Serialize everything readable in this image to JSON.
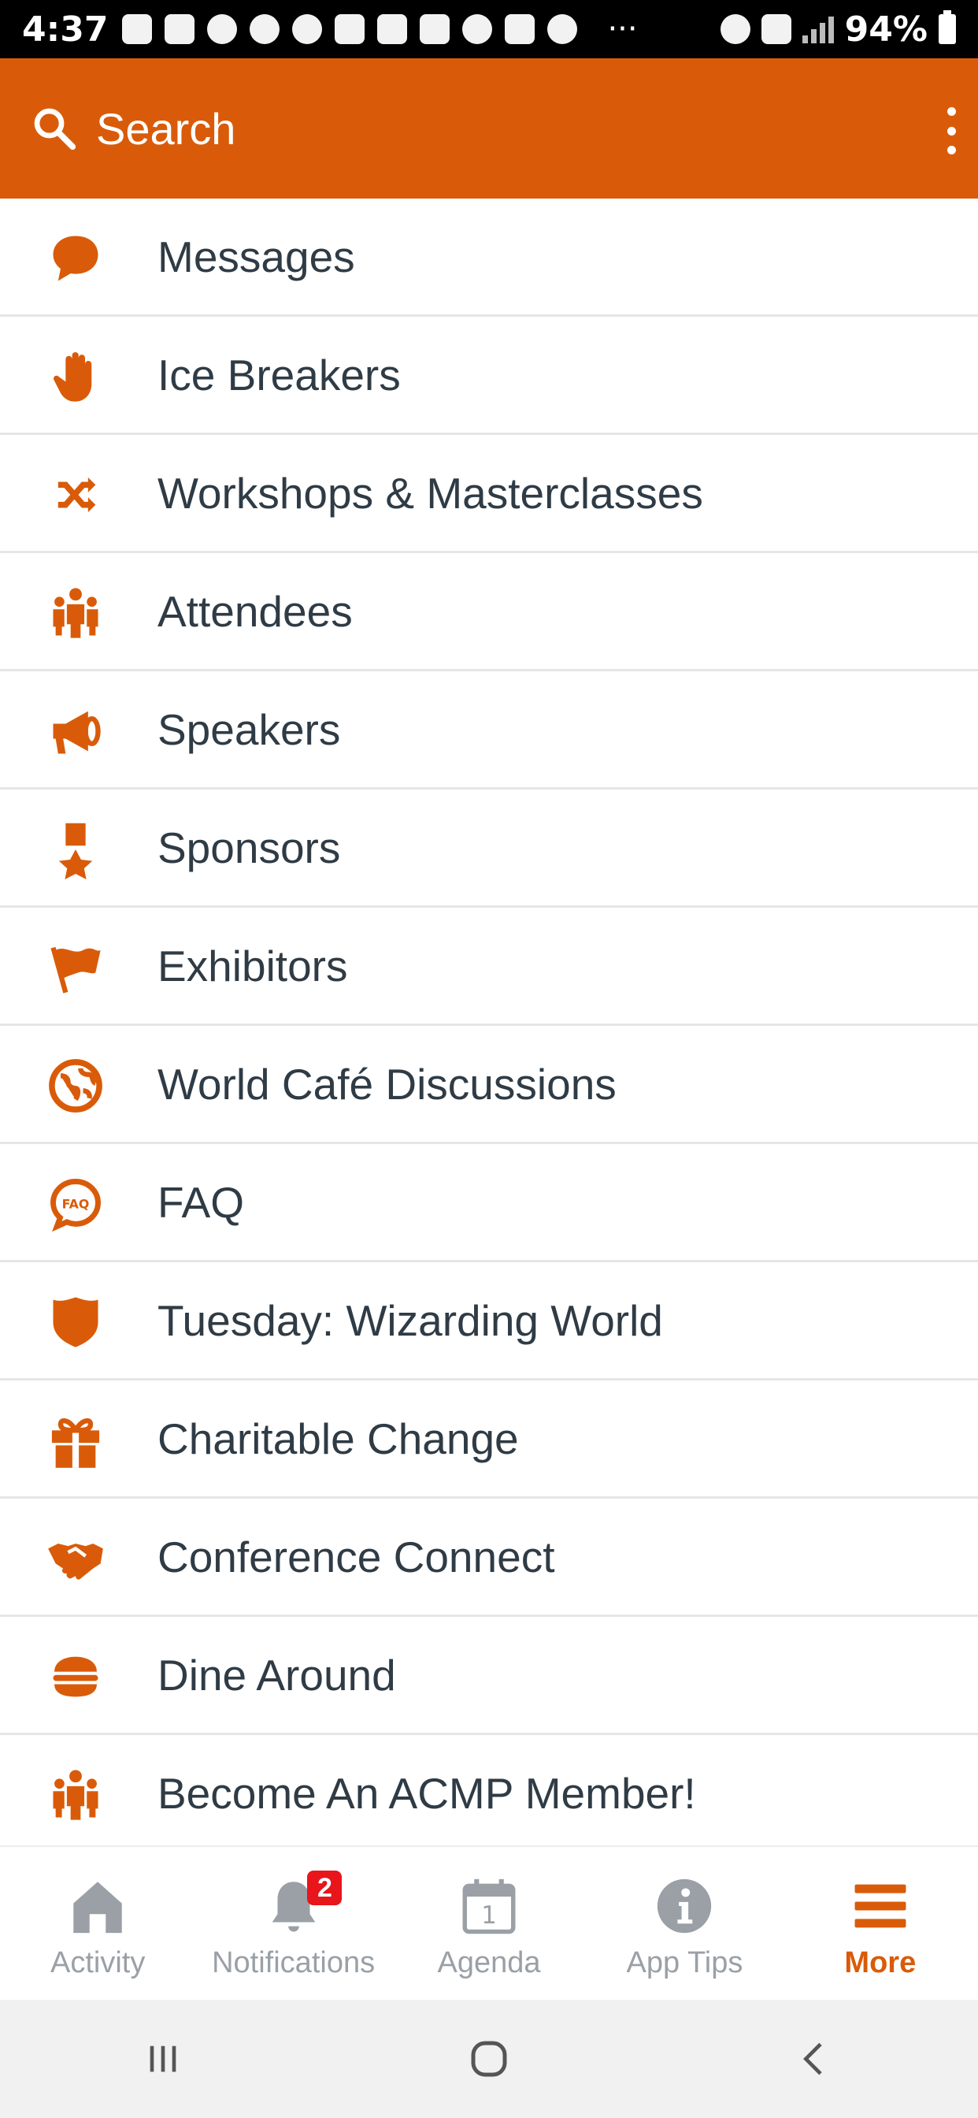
{
  "status_bar": {
    "time": "4:37",
    "battery": "94%"
  },
  "header": {
    "search_label": "Search",
    "accent_color": "#d95b09"
  },
  "menu": {
    "items": [
      {
        "label": "Messages",
        "icon": "chat-bubble-icon"
      },
      {
        "label": "Ice Breakers",
        "icon": "hand-icon"
      },
      {
        "label": "Workshops & Masterclasses",
        "icon": "shuffle-icon"
      },
      {
        "label": "Attendees",
        "icon": "people-icon"
      },
      {
        "label": "Speakers",
        "icon": "megaphone-icon"
      },
      {
        "label": "Sponsors",
        "icon": "medal-icon"
      },
      {
        "label": "Exhibitors",
        "icon": "flag-icon"
      },
      {
        "label": "World Café Discussions",
        "icon": "globe-icon"
      },
      {
        "label": "FAQ",
        "icon": "faq-bubble-icon"
      },
      {
        "label": "Tuesday: Wizarding World",
        "icon": "shield-icon"
      },
      {
        "label": "Charitable Change",
        "icon": "gift-icon"
      },
      {
        "label": "Conference Connect",
        "icon": "handshake-icon"
      },
      {
        "label": "Dine Around",
        "icon": "burger-icon"
      },
      {
        "label": "Become An ACMP Member!",
        "icon": "people-icon"
      }
    ]
  },
  "tab_bar": {
    "tabs": [
      {
        "label": "Activity",
        "icon": "home-icon"
      },
      {
        "label": "Notifications",
        "icon": "bell-icon",
        "badge": "2"
      },
      {
        "label": "Agenda",
        "icon": "calendar-icon",
        "day": "1"
      },
      {
        "label": "App Tips",
        "icon": "info-icon"
      },
      {
        "label": "More",
        "icon": "hamburger-icon",
        "active": true
      }
    ]
  }
}
